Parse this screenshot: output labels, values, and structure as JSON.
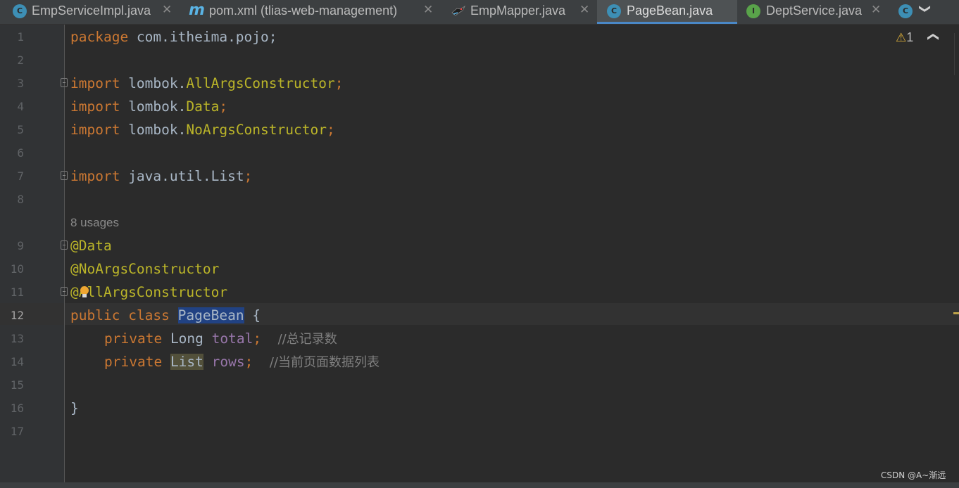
{
  "tabs": [
    {
      "label": "EmpServiceImpl.java",
      "icon": "class-icon",
      "active": false
    },
    {
      "label": "pom.xml (tlias-web-management)",
      "icon": "maven-icon",
      "active": false
    },
    {
      "label": "EmpMapper.java",
      "icon": "mybatis-bird-icon",
      "active": false
    },
    {
      "label": "PageBean.java",
      "icon": "class-icon",
      "active": true
    },
    {
      "label": "DeptService.java",
      "icon": "interface-icon",
      "active": false
    }
  ],
  "tab_icon_letters": {
    "class": "C",
    "interface": "I",
    "maven": "m"
  },
  "inspection": {
    "warnings": "1",
    "icon": "warning-triangle-icon"
  },
  "line_numbers": [
    "1",
    "2",
    "3",
    "4",
    "5",
    "6",
    "7",
    "8",
    "9",
    "10",
    "11",
    "12",
    "13",
    "14",
    "15",
    "16",
    "17"
  ],
  "code": {
    "l1": {
      "kw": "package",
      "rest": " com.itheima.pojo;"
    },
    "l3": {
      "kw": "import",
      "pkg": " lombok.",
      "cls": "AllArgsConstructor",
      "semi": ";"
    },
    "l4": {
      "kw": "import",
      "pkg": " lombok.",
      "cls": "Data",
      "semi": ";"
    },
    "l5": {
      "kw": "import",
      "pkg": " lombok.",
      "cls": "NoArgsConstructor",
      "semi": ";"
    },
    "l7": {
      "kw": "import",
      "rest": " java.util.List",
      "semi": ";"
    },
    "usages": "8 usages",
    "l9": "@Data",
    "l10": "@NoArgsConstructor",
    "l11": "@AllArgsConstructor",
    "l12": {
      "kw1": "public",
      "kw2": "class",
      "name": "PageBean",
      "brace": " {"
    },
    "l13": {
      "kw": "private",
      "type": "Long",
      "field": "total",
      "semi": ";",
      "comment": "//总记录数"
    },
    "l14": {
      "kw": "private",
      "type": "List",
      "field": "rows",
      "semi": ";",
      "comment": "//当前页面数据列表"
    },
    "l16": "}"
  },
  "watermark": "CSDN @A~渐远",
  "colors": {
    "keyword": "#cc7832",
    "annotation": "#bbb529",
    "field": "#9876aa",
    "comment": "#808080",
    "default": "#a9b7c6",
    "accent": "#4a88c7"
  }
}
